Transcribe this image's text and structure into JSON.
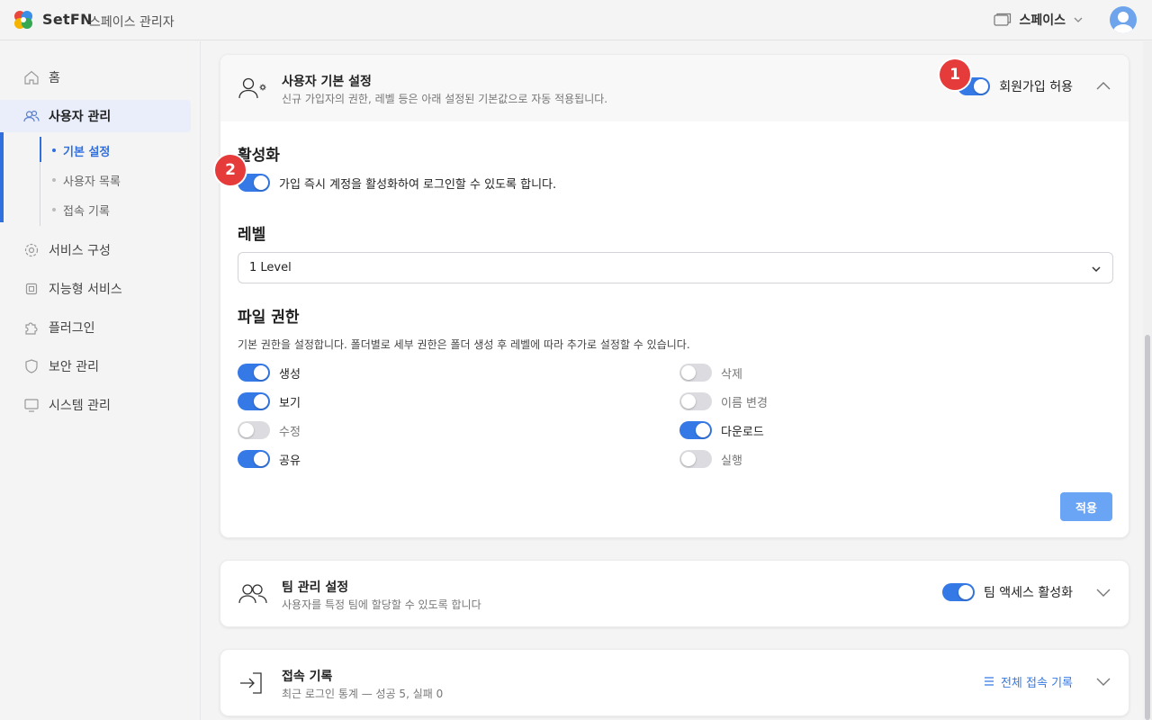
{
  "header": {
    "brand": "SetFN",
    "subtitle": "스페이스 관리자",
    "space_label": "스페이스"
  },
  "sidebar": {
    "items": [
      {
        "label": "홈",
        "icon": "home-icon"
      },
      {
        "label": "사용자 관리",
        "icon": "users-icon"
      },
      {
        "label": "서비스 구성",
        "icon": "gear-icon"
      },
      {
        "label": "지능형 서비스",
        "icon": "chip-icon"
      },
      {
        "label": "플러그인",
        "icon": "puzzle-icon"
      },
      {
        "label": "보안 관리",
        "icon": "shield-icon"
      },
      {
        "label": "시스템 관리",
        "icon": "monitor-icon"
      }
    ],
    "sub_items": [
      {
        "label": "기본 설정"
      },
      {
        "label": "사용자 목록"
      },
      {
        "label": "접속 기록"
      }
    ]
  },
  "user_settings": {
    "title": "사용자 기본 설정",
    "description": "신규 가입자의 권한, 레벨 등은 아래 설정된 기본값으로 자동 적용됩니다.",
    "signup_label": "회원가입 허용",
    "signup_enabled": true,
    "activation": {
      "title": "활성화",
      "label": "가입 즉시 계정을 활성화하여 로그인할 수 있도록 합니다.",
      "enabled": true
    },
    "level": {
      "title": "레벨",
      "value": "1 Level"
    },
    "file_permissions": {
      "title": "파일 권한",
      "description": "기본 권한을 설정합니다. 폴더별로 세부 권한은 폴더 생성 후 레벨에 따라 추가로 설정할 수 있습니다.",
      "left": [
        {
          "label": "생성",
          "enabled": true
        },
        {
          "label": "보기",
          "enabled": true
        },
        {
          "label": "수정",
          "enabled": false
        },
        {
          "label": "공유",
          "enabled": true
        }
      ],
      "right": [
        {
          "label": "삭제",
          "enabled": false
        },
        {
          "label": "이름 변경",
          "enabled": false
        },
        {
          "label": "다운로드",
          "enabled": true
        },
        {
          "label": "실행",
          "enabled": false
        }
      ]
    },
    "apply_label": "적용"
  },
  "team_settings": {
    "title": "팀 관리 설정",
    "description": "사용자를 특정 팀에 할당할 수 있도록 합니다",
    "toggle_label": "팀 액세스 활성화",
    "enabled": true
  },
  "access_log": {
    "title": "접속 기록",
    "description": "최근 로그인 통계 — 성공 5, 실패 0",
    "link_label": "전체 접속 기록"
  },
  "annotations": [
    "1",
    "2"
  ],
  "colors": {
    "accent": "#3579e6",
    "badge": "#e53b3b",
    "apply_button": "#6aa5f5"
  }
}
